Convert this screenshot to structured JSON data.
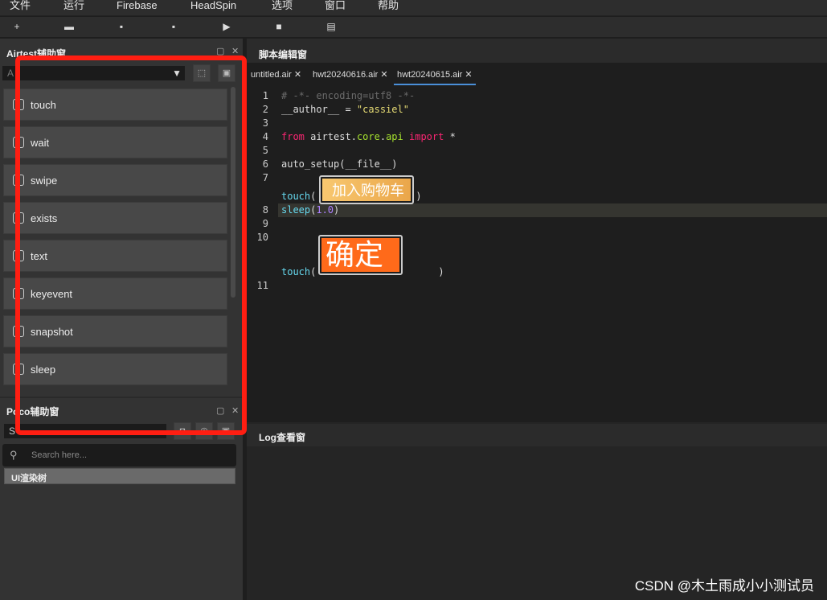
{
  "menu": [
    "文件",
    "运行",
    "Firebase",
    "HeadSpin",
    "选项",
    "窗口",
    "帮助"
  ],
  "toolbar": [
    {
      "icon": "new-icon",
      "g": "+"
    },
    {
      "icon": "open-folder-icon",
      "g": "▬"
    },
    {
      "icon": "save-icon",
      "g": "▪"
    },
    {
      "icon": "save-as-icon",
      "g": "▪"
    },
    {
      "icon": "run-icon",
      "g": "▶"
    },
    {
      "icon": "stop-icon",
      "g": "■"
    },
    {
      "icon": "log-icon",
      "g": "▤"
    }
  ],
  "airtest_panel": {
    "title": "Airtest辅助窗",
    "combo_value": "A",
    "items": [
      {
        "label": "touch",
        "icon": "touch-icon"
      },
      {
        "label": "wait",
        "icon": "wait-icon"
      },
      {
        "label": "swipe",
        "icon": "swipe-icon"
      },
      {
        "label": "exists",
        "icon": "exists-icon"
      },
      {
        "label": "text",
        "icon": "text-icon"
      },
      {
        "label": "keyevent",
        "icon": "keyevent-icon"
      },
      {
        "label": "snapshot",
        "icon": "snapshot-icon"
      },
      {
        "label": "sleep",
        "icon": "sleep-icon"
      }
    ]
  },
  "poco_panel": {
    "title": "Poco辅助窗",
    "combo_value": "S",
    "search_placeholder": "Search here...",
    "tree_label": "UI渲染树"
  },
  "editor": {
    "title": "脚本编辑窗",
    "tabs": [
      "untitled.air",
      "hwt20240616.air",
      "hwt20240615.air"
    ],
    "active_tab": 2,
    "image_1_text": "加入购物车",
    "image_2_text": "确定",
    "line_numbers": [
      "1",
      "2",
      "3",
      "4",
      "5",
      "6",
      "7",
      "8",
      "9",
      "10",
      "11"
    ]
  },
  "log_panel": {
    "title": "Log查看窗"
  },
  "watermark": "CSDN @木土雨成小小测试员",
  "colors": {
    "annotation": "#ff1e12",
    "image1": "#f5b85a",
    "image2": "#ff6a1a"
  }
}
